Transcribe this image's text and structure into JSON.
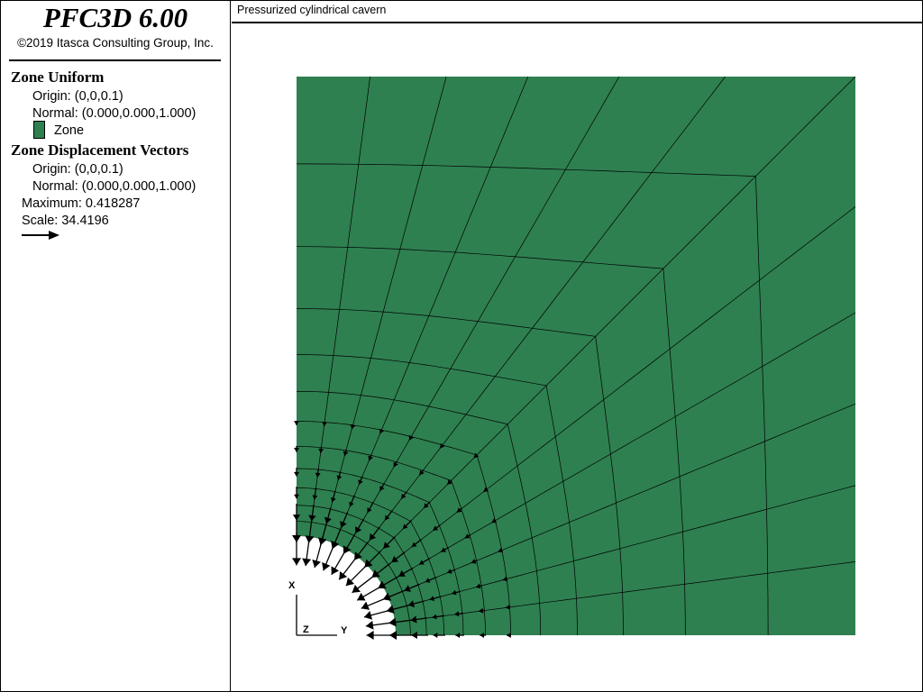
{
  "app": {
    "title": "PFC3D 6.00",
    "copyright": "©2019 Itasca Consulting Group, Inc."
  },
  "plot_title": "Pressurized cylindrical cavern",
  "legend": {
    "zone_uniform": {
      "heading": "Zone Uniform",
      "origin": "Origin: (0,0,0.1)",
      "normal": "Normal: (0.000,0.000,1.000)",
      "item_label": "Zone",
      "item_color": "#2e8050"
    },
    "displacement": {
      "heading": "Zone Displacement Vectors",
      "origin": "Origin: (0,0,0.1)",
      "normal": "Normal: (0.000,0.000,1.000)",
      "maximum": "Maximum: 0.418287",
      "scale": "Scale: 34.4196",
      "arrow_icon": "right-arrow-icon"
    }
  },
  "axes": {
    "x_label": "X",
    "y_label": "Y",
    "z_label": "Z"
  },
  "colors": {
    "zone_fill": "#2e8050",
    "grid_line": "#000000",
    "vector": "#000000"
  }
}
